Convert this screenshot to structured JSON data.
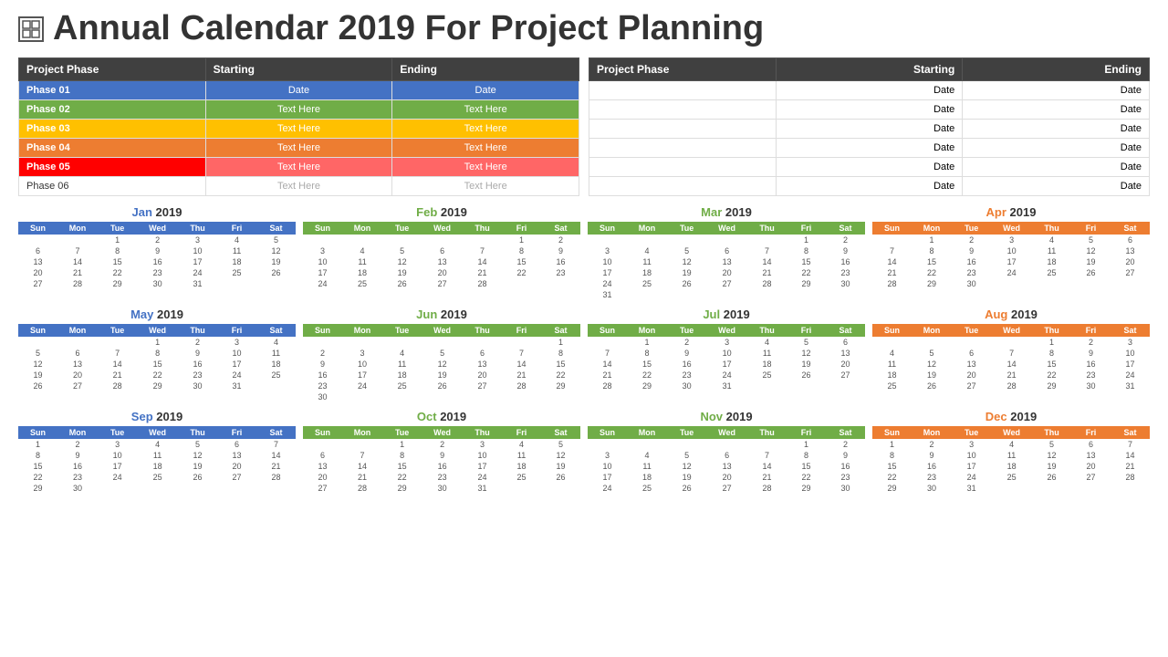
{
  "title": "Annual Calendar 2019 For Project Planning",
  "phases_left": {
    "headers": [
      "Project Phase",
      "Starting",
      "Ending"
    ],
    "rows": [
      {
        "phase": "Phase 01",
        "starting": "Date",
        "ending": "Date",
        "color": "blue"
      },
      {
        "phase": "Phase 02",
        "starting": "Text Here",
        "ending": "Text Here",
        "color": "green"
      },
      {
        "phase": "Phase 03",
        "starting": "Text Here",
        "ending": "Text Here",
        "color": "yellow"
      },
      {
        "phase": "Phase 04",
        "starting": "Text Here",
        "ending": "Text Here",
        "color": "orange"
      },
      {
        "phase": "Phase 05",
        "starting": "Text Here",
        "ending": "Text Here",
        "color": "red"
      },
      {
        "phase": "Phase 06",
        "starting": "Text Here",
        "ending": "Text Here",
        "color": "white"
      }
    ]
  },
  "phases_right": {
    "headers": [
      "Project Phase",
      "Starting",
      "Ending"
    ],
    "rows": [
      {
        "phase": "",
        "starting": "Date",
        "ending": "Date"
      },
      {
        "phase": "",
        "starting": "Date",
        "ending": "Date"
      },
      {
        "phase": "",
        "starting": "Date",
        "ending": "Date"
      },
      {
        "phase": "",
        "starting": "Date",
        "ending": "Date"
      },
      {
        "phase": "",
        "starting": "Date",
        "ending": "Date"
      },
      {
        "phase": "",
        "starting": "Date",
        "ending": "Date"
      }
    ]
  },
  "months": [
    {
      "name": "Jan",
      "year": "2019",
      "color_class": "jan",
      "days": [
        "Sun",
        "Mon",
        "Tue",
        "Wed",
        "Thu",
        "Fri",
        "Sat"
      ],
      "weeks": [
        [
          "",
          "",
          "1",
          "2",
          "3",
          "4",
          "5"
        ],
        [
          "6",
          "7",
          "8",
          "9",
          "10",
          "11",
          "12"
        ],
        [
          "13",
          "14",
          "15",
          "16",
          "17",
          "18",
          "19"
        ],
        [
          "20",
          "21",
          "22",
          "23",
          "24",
          "25",
          "26"
        ],
        [
          "27",
          "28",
          "29",
          "30",
          "31",
          "",
          ""
        ]
      ]
    },
    {
      "name": "Feb",
      "year": "2019",
      "color_class": "feb",
      "days": [
        "Sun",
        "Mon",
        "Tue",
        "Wed",
        "Thu",
        "Fri",
        "Sat"
      ],
      "weeks": [
        [
          "",
          "",
          "",
          "",
          "",
          "1",
          "2"
        ],
        [
          "3",
          "4",
          "5",
          "6",
          "7",
          "8",
          "9"
        ],
        [
          "10",
          "11",
          "12",
          "13",
          "14",
          "15",
          "16"
        ],
        [
          "17",
          "18",
          "19",
          "20",
          "21",
          "22",
          "23"
        ],
        [
          "24",
          "25",
          "26",
          "27",
          "28",
          "",
          ""
        ]
      ]
    },
    {
      "name": "Mar",
      "year": "2019",
      "color_class": "mar",
      "days": [
        "Sun",
        "Mon",
        "Tue",
        "Wed",
        "Thu",
        "Fri",
        "Sat"
      ],
      "weeks": [
        [
          "",
          "",
          "",
          "",
          "",
          "1",
          "2"
        ],
        [
          "3",
          "4",
          "5",
          "6",
          "7",
          "8",
          "9"
        ],
        [
          "10",
          "11",
          "12",
          "13",
          "14",
          "15",
          "16"
        ],
        [
          "17",
          "18",
          "19",
          "20",
          "21",
          "22",
          "23"
        ],
        [
          "24",
          "25",
          "26",
          "27",
          "28",
          "29",
          "30"
        ],
        [
          "31",
          "",
          "",
          "",
          "",
          "",
          ""
        ]
      ]
    },
    {
      "name": "Apr",
      "year": "2019",
      "color_class": "apr",
      "days": [
        "Sun",
        "Mon",
        "Tue",
        "Wed",
        "Thu",
        "Fri",
        "Sat"
      ],
      "weeks": [
        [
          "",
          "1",
          "2",
          "3",
          "4",
          "5",
          "6"
        ],
        [
          "7",
          "8",
          "9",
          "10",
          "11",
          "12",
          "13"
        ],
        [
          "14",
          "15",
          "16",
          "17",
          "18",
          "19",
          "20"
        ],
        [
          "21",
          "22",
          "23",
          "24",
          "25",
          "26",
          "27"
        ],
        [
          "28",
          "29",
          "30",
          "",
          "",
          "",
          ""
        ]
      ]
    },
    {
      "name": "May",
      "year": "2019",
      "color_class": "may",
      "days": [
        "Sun",
        "Mon",
        "Tue",
        "Wed",
        "Thu",
        "Fri",
        "Sat"
      ],
      "weeks": [
        [
          "",
          "",
          "",
          "1",
          "2",
          "3",
          "4"
        ],
        [
          "5",
          "6",
          "7",
          "8",
          "9",
          "10",
          "11"
        ],
        [
          "12",
          "13",
          "14",
          "15",
          "16",
          "17",
          "18"
        ],
        [
          "19",
          "20",
          "21",
          "22",
          "23",
          "24",
          "25"
        ],
        [
          "26",
          "27",
          "28",
          "29",
          "30",
          "31",
          ""
        ]
      ]
    },
    {
      "name": "Jun",
      "year": "2019",
      "color_class": "jun",
      "days": [
        "Sun",
        "Mon",
        "Tue",
        "Wed",
        "Thu",
        "Fri",
        "Sat"
      ],
      "weeks": [
        [
          "",
          "",
          "",
          "",
          "",
          "",
          "1"
        ],
        [
          "2",
          "3",
          "4",
          "5",
          "6",
          "7",
          "8"
        ],
        [
          "9",
          "10",
          "11",
          "12",
          "13",
          "14",
          "15"
        ],
        [
          "16",
          "17",
          "18",
          "19",
          "20",
          "21",
          "22"
        ],
        [
          "23",
          "24",
          "25",
          "26",
          "27",
          "28",
          "29"
        ],
        [
          "30",
          "",
          "",
          "",
          "",
          "",
          ""
        ]
      ]
    },
    {
      "name": "Jul",
      "year": "2019",
      "color_class": "jul",
      "days": [
        "Sun",
        "Mon",
        "Tue",
        "Wed",
        "Thu",
        "Fri",
        "Sat"
      ],
      "weeks": [
        [
          "",
          "1",
          "2",
          "3",
          "4",
          "5",
          "6"
        ],
        [
          "7",
          "8",
          "9",
          "10",
          "11",
          "12",
          "13"
        ],
        [
          "14",
          "15",
          "16",
          "17",
          "18",
          "19",
          "20"
        ],
        [
          "21",
          "22",
          "23",
          "24",
          "25",
          "26",
          "27"
        ],
        [
          "28",
          "29",
          "30",
          "31",
          "",
          "",
          ""
        ]
      ]
    },
    {
      "name": "Aug",
      "year": "2019",
      "color_class": "aug",
      "days": [
        "Sun",
        "Mon",
        "Tue",
        "Wed",
        "Thu",
        "Fri",
        "Sat"
      ],
      "weeks": [
        [
          "",
          "",
          "",
          "",
          "1",
          "2",
          "3"
        ],
        [
          "4",
          "5",
          "6",
          "7",
          "8",
          "9",
          "10"
        ],
        [
          "11",
          "12",
          "13",
          "14",
          "15",
          "16",
          "17"
        ],
        [
          "18",
          "19",
          "20",
          "21",
          "22",
          "23",
          "24"
        ],
        [
          "25",
          "26",
          "27",
          "28",
          "29",
          "30",
          "31"
        ]
      ]
    },
    {
      "name": "Sep",
      "year": "2019",
      "color_class": "sep",
      "days": [
        "Sun",
        "Mon",
        "Tue",
        "Wed",
        "Thu",
        "Fri",
        "Sat"
      ],
      "weeks": [
        [
          "1",
          "2",
          "3",
          "4",
          "5",
          "6",
          "7"
        ],
        [
          "8",
          "9",
          "10",
          "11",
          "12",
          "13",
          "14"
        ],
        [
          "15",
          "16",
          "17",
          "18",
          "19",
          "20",
          "21"
        ],
        [
          "22",
          "23",
          "24",
          "25",
          "26",
          "27",
          "28"
        ],
        [
          "29",
          "30",
          "",
          "",
          "",
          "",
          ""
        ]
      ]
    },
    {
      "name": "Oct",
      "year": "2019",
      "color_class": "oct",
      "days": [
        "Sun",
        "Mon",
        "Tue",
        "Wed",
        "Thu",
        "Fri",
        "Sat"
      ],
      "weeks": [
        [
          "",
          "",
          "1",
          "2",
          "3",
          "4",
          "5"
        ],
        [
          "6",
          "7",
          "8",
          "9",
          "10",
          "11",
          "12"
        ],
        [
          "13",
          "14",
          "15",
          "16",
          "17",
          "18",
          "19"
        ],
        [
          "20",
          "21",
          "22",
          "23",
          "24",
          "25",
          "26"
        ],
        [
          "27",
          "28",
          "29",
          "30",
          "31",
          "",
          ""
        ]
      ]
    },
    {
      "name": "Nov",
      "year": "2019",
      "color_class": "nov",
      "days": [
        "Sun",
        "Mon",
        "Tue",
        "Wed",
        "Thu",
        "Fri",
        "Sat"
      ],
      "weeks": [
        [
          "",
          "",
          "",
          "",
          "",
          "1",
          "2"
        ],
        [
          "3",
          "4",
          "5",
          "6",
          "7",
          "8",
          "9"
        ],
        [
          "10",
          "11",
          "12",
          "13",
          "14",
          "15",
          "16"
        ],
        [
          "17",
          "18",
          "19",
          "20",
          "21",
          "22",
          "23"
        ],
        [
          "24",
          "25",
          "26",
          "27",
          "28",
          "29",
          "30"
        ]
      ]
    },
    {
      "name": "Dec",
      "year": "2019",
      "color_class": "dec",
      "days": [
        "Sun",
        "Mon",
        "Tue",
        "Wed",
        "Thu",
        "Fri",
        "Sat"
      ],
      "weeks": [
        [
          "1",
          "2",
          "3",
          "4",
          "5",
          "6",
          "7"
        ],
        [
          "8",
          "9",
          "10",
          "11",
          "12",
          "13",
          "14"
        ],
        [
          "15",
          "16",
          "17",
          "18",
          "19",
          "20",
          "21"
        ],
        [
          "22",
          "23",
          "24",
          "25",
          "26",
          "27",
          "28"
        ],
        [
          "29",
          "30",
          "31",
          "",
          "",
          "",
          ""
        ]
      ]
    }
  ]
}
